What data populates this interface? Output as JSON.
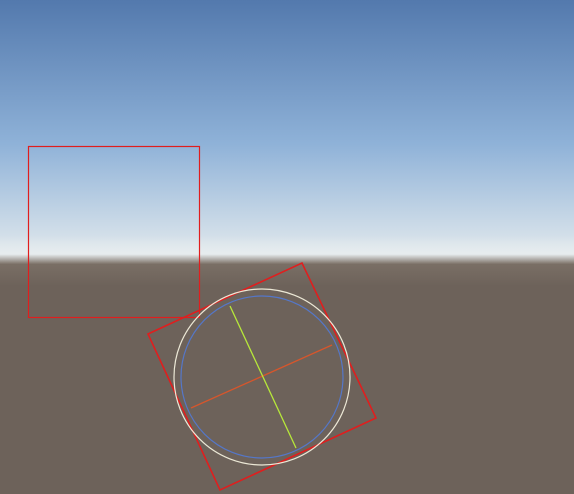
{
  "scene": {
    "sky_top_color": "#5379ad",
    "sky_mid_color": "#8fb2d8",
    "sky_horizon_color": "#e6ecee",
    "ground_color": "#6d625a",
    "ground_horizon_color": "#7d7268"
  },
  "gizmos": {
    "box_collider_color": "#e01e1e",
    "circle_outer_color": "#ece8d6",
    "circle_inner_color": "#5577c8",
    "axis_red_color": "#d6562c",
    "axis_green_color": "#b7e83a"
  }
}
